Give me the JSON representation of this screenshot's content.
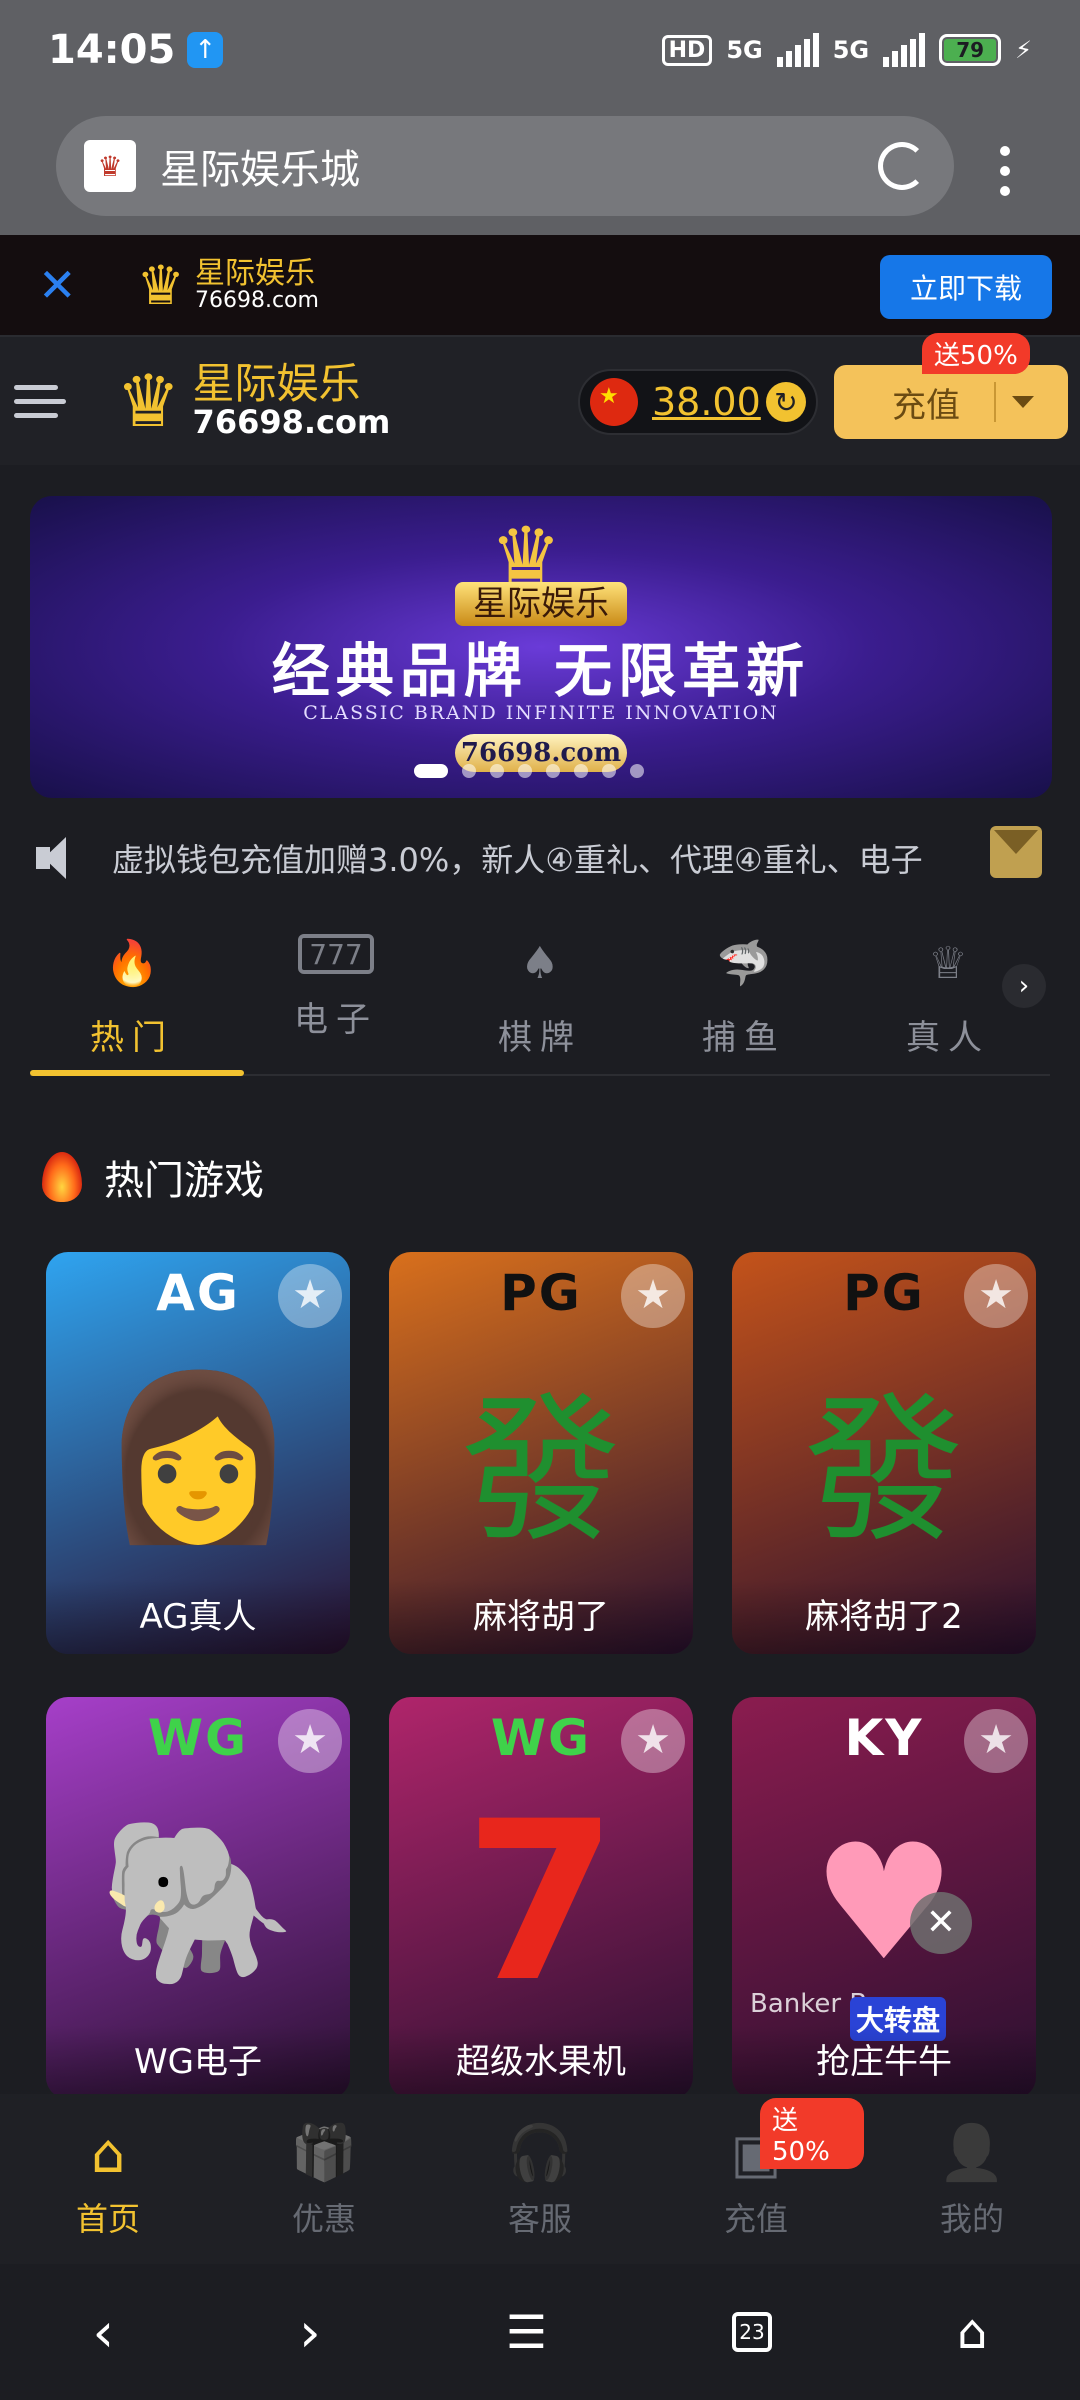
{
  "status_bar": {
    "time": "14:05",
    "network_type": "HD",
    "signal_1": "5G",
    "signal_2": "5G",
    "battery": "79"
  },
  "browser": {
    "page_title": "星际娱乐城"
  },
  "download_banner": {
    "button_label": "立即下载",
    "logo_name": "星际娱乐",
    "logo_domain": "76698.com"
  },
  "header": {
    "logo_name": "星际娱乐",
    "logo_domain": "76698.com",
    "balance": "38.00",
    "recharge_label": "充值",
    "promo_badge": "送50%"
  },
  "hero": {
    "brand": "星际娱乐",
    "title": "经典品牌 无限革新",
    "subtitle": "CLASSIC BRAND INFINITE INNOVATION",
    "domain": "76698.com",
    "slides_count": 8,
    "active_slide": 0
  },
  "marquee": {
    "text": "虚拟钱包充值加赠3.0%，新人④重礼、代理④重礼、电子"
  },
  "category_tabs": [
    {
      "label": "热门",
      "icon": "fire-icon",
      "active": true
    },
    {
      "label": "电子",
      "icon": "slot-777-icon",
      "active": false
    },
    {
      "label": "棋牌",
      "icon": "cards-icon",
      "active": false
    },
    {
      "label": "捕鱼",
      "icon": "shark-icon",
      "active": false
    },
    {
      "label": "真人",
      "icon": "dealer-icon",
      "active": false
    }
  ],
  "section": {
    "title": "热门游戏"
  },
  "games": [
    {
      "provider": "AG",
      "name": "AG真人",
      "bg": "#2fa4f0",
      "provider_color": "#ffffff",
      "art": "portrait-icon"
    },
    {
      "provider": "PG",
      "name": "麻将胡了",
      "bg": "#d9701c",
      "provider_color": "#111111",
      "art": "mahjong-icon"
    },
    {
      "provider": "PG",
      "name": "麻将胡了2",
      "bg": "#c4531a",
      "provider_color": "#111111",
      "art": "dragon-mahjong-icon"
    },
    {
      "provider": "WG",
      "name": "WG电子",
      "bg": "#a63fc9",
      "provider_color": "#3fd24a",
      "art": "elephant-icon"
    },
    {
      "provider": "WG",
      "name": "超级水果机",
      "bg": "#b0256b",
      "provider_color": "#3fd24a",
      "art": "seven-icon"
    },
    {
      "provider": "KY",
      "name": "抢庄牛牛",
      "bg": "#8b1c4f",
      "provider_color": "#ffffff",
      "art": "dealer-card-icon",
      "overlay_label": "大转盘",
      "overlay_text": "Banker B"
    }
  ],
  "bottom_nav": [
    {
      "label": "首页",
      "icon": "home-icon",
      "active": true
    },
    {
      "label": "优惠",
      "icon": "gift-icon",
      "active": false
    },
    {
      "label": "客服",
      "icon": "headset-icon",
      "active": false
    },
    {
      "label": "充值",
      "icon": "wallet-icon",
      "active": false,
      "badge": "送50%"
    },
    {
      "label": "我的",
      "icon": "user-icon",
      "active": false
    }
  ],
  "system_nav": {
    "tabs_count": "23"
  }
}
